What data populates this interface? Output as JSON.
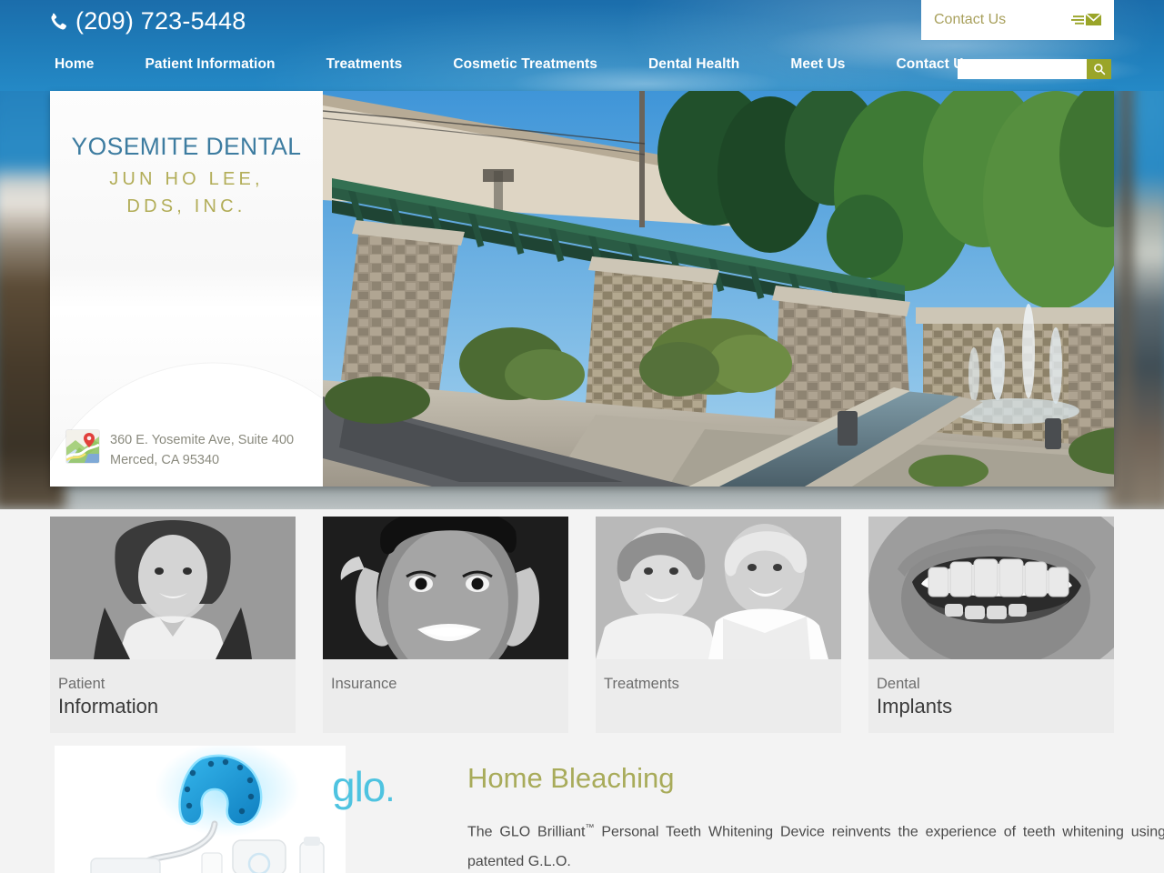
{
  "header": {
    "phone": "(209) 723-5448",
    "phone_icon": "phone-icon",
    "nav": [
      {
        "label": "Home"
      },
      {
        "label": "Patient Information"
      },
      {
        "label": "Treatments"
      },
      {
        "label": "Cosmetic Treatments"
      },
      {
        "label": "Dental Health"
      },
      {
        "label": "Meet Us"
      },
      {
        "label": "Contact Us"
      }
    ],
    "search": {
      "value": "",
      "placeholder": "",
      "icon": "search-icon"
    },
    "contact_box": {
      "label": "Contact Us",
      "icon": "envelope-icon"
    },
    "colors": {
      "blue_top": "#1b6dab",
      "blue_bottom": "#2489c6",
      "olive": "#9aa529"
    }
  },
  "hero": {
    "logo": {
      "title": "YOSEMITE DENTAL",
      "subtitle": "JUN HO LEE,\nDDS, INC.",
      "subtitle_line1": "JUN HO LEE,",
      "subtitle_line2": "DDS, INC.",
      "title_color": "#3d7ca0",
      "subtitle_color": "#b2ad58"
    },
    "address": {
      "icon": "map-pin-icon",
      "line1": "360 E. Yosemite Ave, Suite 400",
      "line2": "Merced, CA 95340"
    },
    "photo_alt": "office-exterior-stone-wall-fountain-photo"
  },
  "cards": [
    {
      "line1": "Patient",
      "line2": "Information",
      "image": "smiling-woman-photo"
    },
    {
      "line1": "Insurance",
      "line2": "",
      "image": "smiling-woman-hands-face-photo"
    },
    {
      "line1": "Treatments",
      "line2": "",
      "image": "smiling-senior-couple-photo"
    },
    {
      "line1": "Dental",
      "line2": "Implants",
      "image": "open-smile-teeth-photo"
    }
  ],
  "glo": {
    "logo_text": "glo",
    "logo_dot": ".",
    "heading": "Home Bleaching",
    "body_before": "The GLO Brilliant",
    "body_tm": "™",
    "body_after": " Personal Teeth Whitening Device reinvents the experience of teeth whitening using patented G.L.O.",
    "product_image": "glo-brilliant-whitening-device-photo",
    "heading_color": "#a8ab5a",
    "logo_color": "#4ec3e0"
  }
}
